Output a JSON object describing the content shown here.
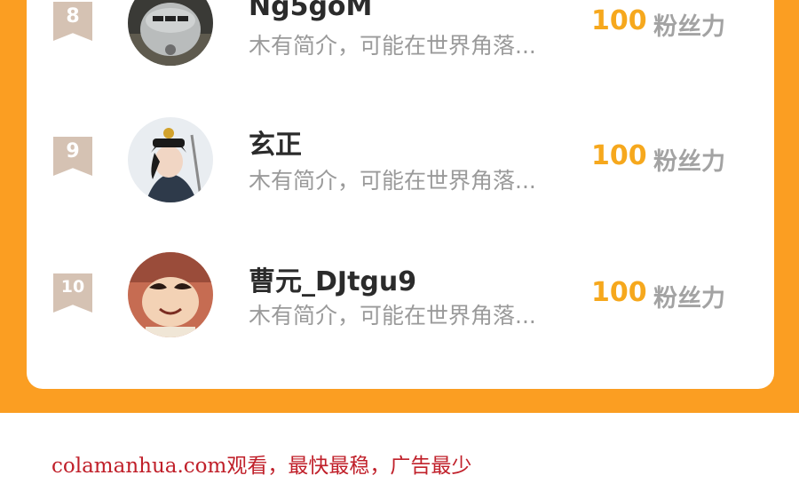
{
  "rows": [
    {
      "rank": "8",
      "name": "Ng5goM",
      "intro": "木有简介，可能在世界角落...",
      "score": "100",
      "unit": "粉丝力",
      "avatar": "airplane-avatar"
    },
    {
      "rank": "9",
      "name": "玄正",
      "intro": "木有简介，可能在世界角落...",
      "score": "100",
      "unit": "粉丝力",
      "avatar": "qing-official-avatar"
    },
    {
      "rank": "10",
      "name": "曹元_DJtgu9",
      "intro": "木有简介，可能在世界角落...",
      "score": "100",
      "unit": "粉丝力",
      "avatar": "cartoon-boy-avatar"
    }
  ],
  "footer": "colamanhua.com观看，最快最稳，广告最少",
  "colors": {
    "background": "#fb9e22",
    "score": "#f6a81d",
    "rank_badge": "#d5c2b3",
    "footer_text": "#c0202a"
  }
}
